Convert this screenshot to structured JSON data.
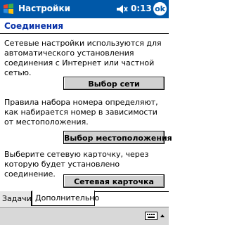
{
  "titlebar": {
    "app_title": "Настройки",
    "time": "0:13",
    "ok_label": "ok",
    "icons": [
      "windows-logo-icon",
      "speaker-icon"
    ]
  },
  "page": {
    "heading": "Соединения",
    "sections": [
      {
        "text": "Сетевые настройки используются для автоматического установления соединения с Интернет или частной сетью.",
        "button": "Выбор сети"
      },
      {
        "text": "Правила набора номера определяют, как набирается номер в зависимости от местоположения.",
        "button": "Выбор местоположения"
      },
      {
        "text": "Выберите сетевую карточку, через которую будет установлено соединение.",
        "button": "Сетевая карточка"
      }
    ]
  },
  "tabs": [
    {
      "label": "Задачи",
      "active": false
    },
    {
      "label": "Дополнительно",
      "active": true
    }
  ],
  "menubar": {
    "icons": [
      "keyboard-icon",
      "caret-up-icon"
    ]
  },
  "colors": {
    "titlebar": "#0058a8",
    "heading": "#0a33a8",
    "button_face": "#d0d0d0"
  }
}
